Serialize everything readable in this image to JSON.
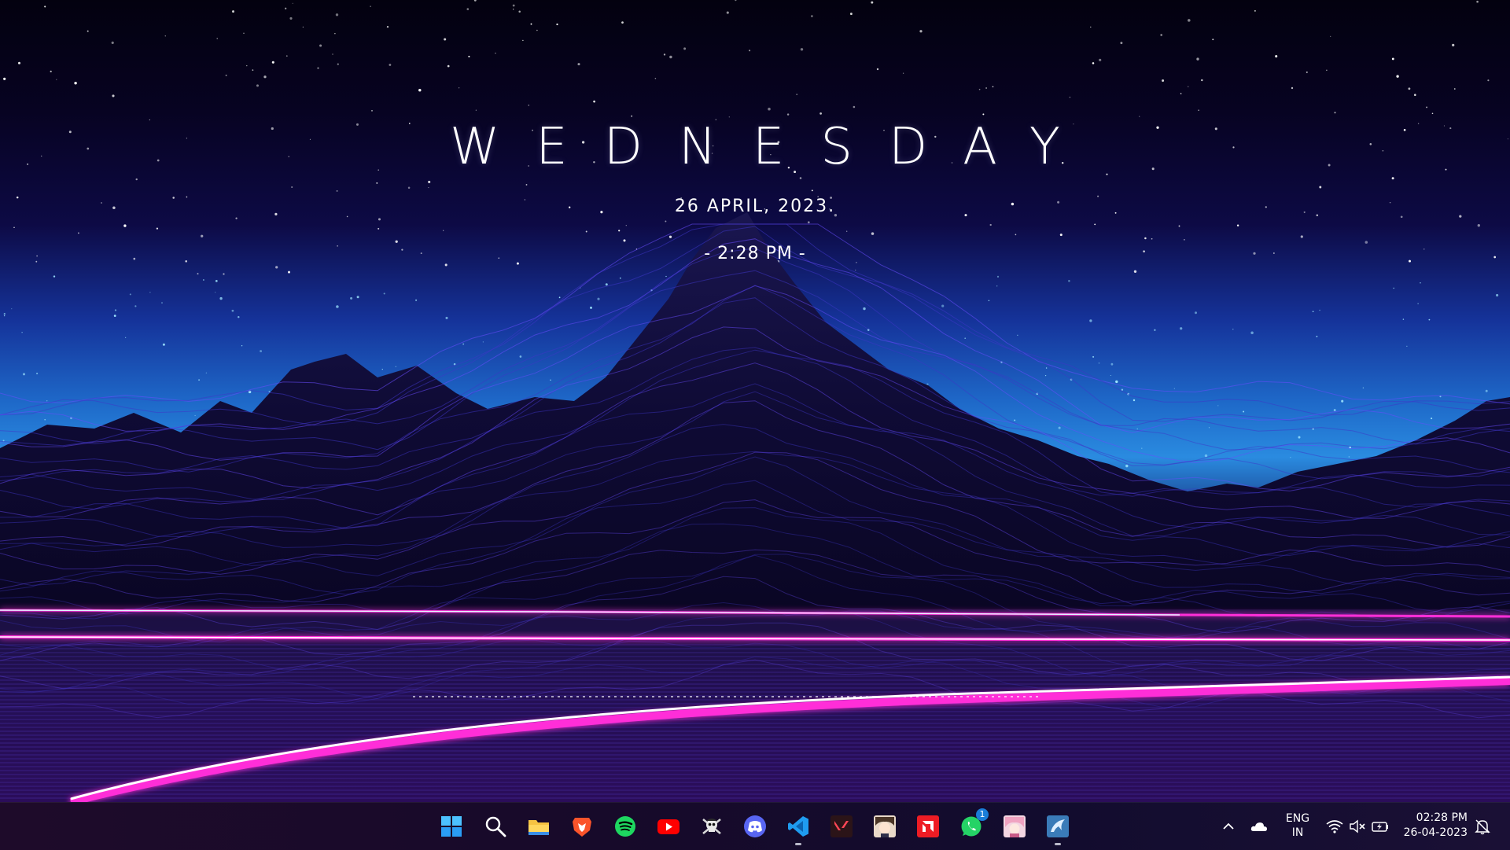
{
  "desktop": {
    "widget": {
      "day": "WEDNESDAY",
      "date": "26 APRIL, 2023.",
      "time": "- 2:28 PM -"
    }
  },
  "taskbar": {
    "apps": [
      {
        "name": "start-button",
        "icon": "windows-logo-icon",
        "running": false
      },
      {
        "name": "search-button",
        "icon": "search-icon",
        "running": false
      },
      {
        "name": "file-explorer",
        "icon": "folder-icon",
        "running": false
      },
      {
        "name": "brave-browser",
        "icon": "brave-lion-icon",
        "running": false
      },
      {
        "name": "spotify",
        "icon": "spotify-icon",
        "running": false
      },
      {
        "name": "youtube",
        "icon": "youtube-icon",
        "running": false
      },
      {
        "name": "pirate-app",
        "icon": "skull-icon",
        "running": false
      },
      {
        "name": "discord",
        "icon": "discord-icon",
        "running": false
      },
      {
        "name": "vscode",
        "icon": "vscode-icon",
        "running": true
      },
      {
        "name": "valorant",
        "icon": "valorant-icon",
        "running": false
      },
      {
        "name": "anime-app-1",
        "icon": "anime-avatar-icon",
        "running": false
      },
      {
        "name": "amd-software",
        "icon": "amd-icon",
        "running": false
      },
      {
        "name": "whatsapp",
        "icon": "whatsapp-icon",
        "running": false,
        "badge": "1"
      },
      {
        "name": "anime-app-2",
        "icon": "anime-avatar-icon",
        "running": false
      },
      {
        "name": "mysql-workbench",
        "icon": "dolphin-icon",
        "running": true
      }
    ],
    "tray": {
      "language_line1": "ENG",
      "language_line2": "IN",
      "time": "02:28 PM",
      "date": "26-04-2023"
    }
  },
  "colors": {
    "neon_pink": "#ff2fd8",
    "neon_white": "#ffffff",
    "mountain_line": "#4a3cff",
    "sky_blue": "#2a8be0"
  }
}
